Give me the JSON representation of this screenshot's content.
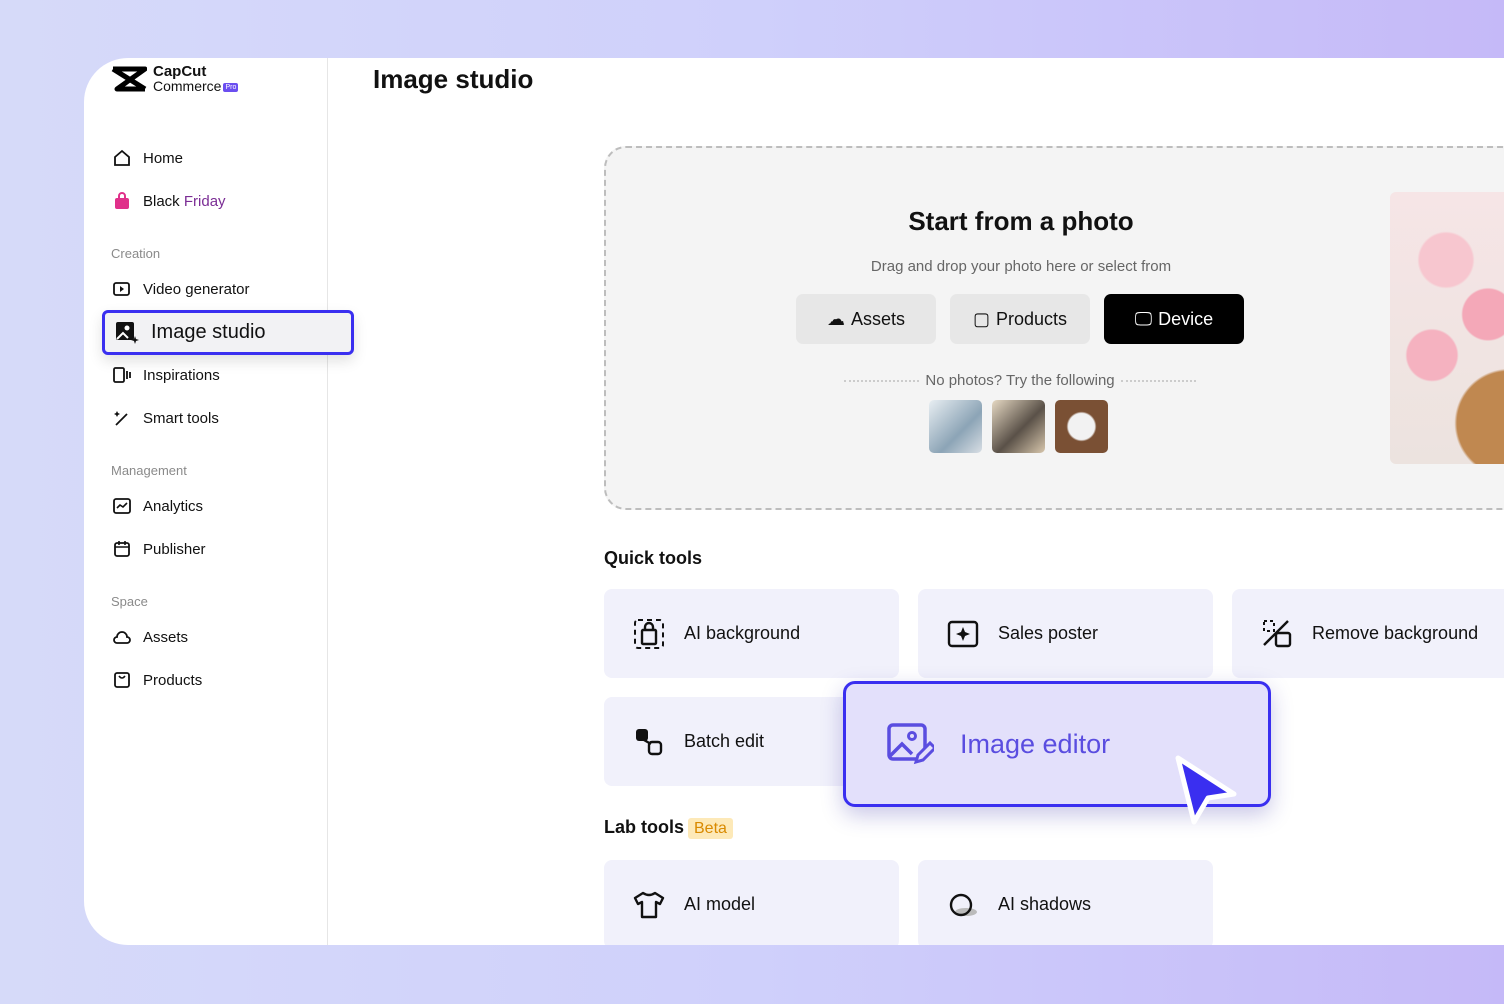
{
  "brand": {
    "name": "CapCut",
    "sub": "Commerce",
    "badge": "Pro"
  },
  "page_title": "Image studio",
  "sidebar": {
    "home": "Home",
    "black": "Black",
    "friday": "Friday",
    "sections": [
      "Creation",
      "Management",
      "Space"
    ],
    "creation": [
      "Video generator",
      "Image studio",
      "Inspirations",
      "Smart tools"
    ],
    "management": [
      "Analytics",
      "Publisher"
    ],
    "space": [
      "Assets",
      "Products"
    ]
  },
  "upload": {
    "title": "Start from a photo",
    "subtitle": "Drag and drop your photo here or select from",
    "buttons": [
      "Assets",
      "Products",
      "Device"
    ],
    "no_photos": "No photos? Try the following"
  },
  "quick_tools": {
    "heading": "Quick tools",
    "items": [
      "AI background",
      "Sales poster",
      "Remove background",
      "Batch edit",
      "Image editor"
    ]
  },
  "lab_tools": {
    "heading": "Lab tools",
    "badge": "Beta",
    "items": [
      "AI model",
      "AI shadows"
    ]
  },
  "colors": {
    "accent": "#3a2ff0",
    "card": "#f1f1fb",
    "beta_bg": "#fde9b8"
  }
}
